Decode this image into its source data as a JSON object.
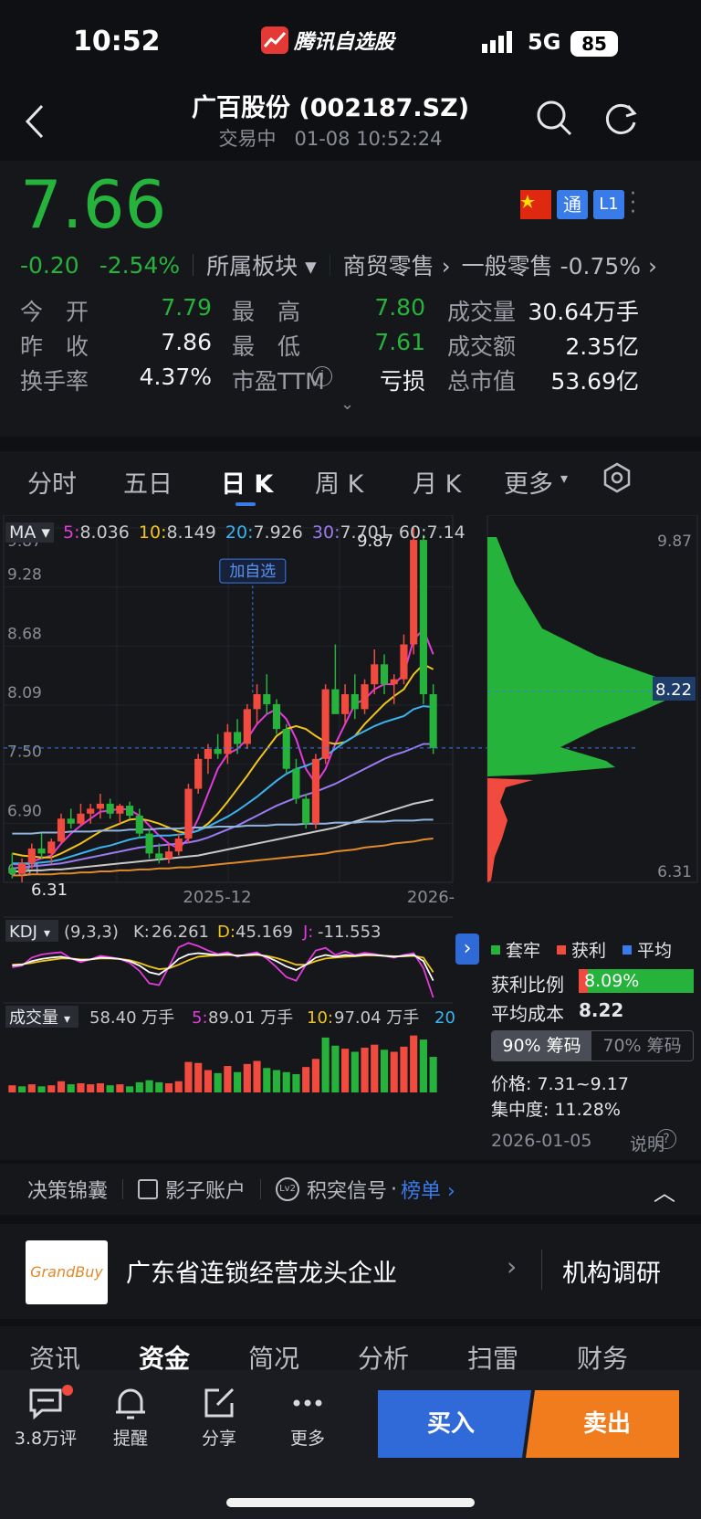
{
  "status": {
    "time": "10:52",
    "app_name": "腾讯自选股",
    "network": "5G",
    "battery": "85"
  },
  "header": {
    "title": "广百股份 (002187.SZ)",
    "state": "交易中",
    "datetime": "01-08 10:52:24"
  },
  "quote": {
    "price": "7.66",
    "change": "-0.20",
    "change_pct": "-2.54%",
    "sector_label": "所属板块",
    "sector1": "商贸零售",
    "sector2": "一般零售",
    "sector2_pct": "-0.75%",
    "badge_tong": "通",
    "badge_l1": "L1",
    "stats": [
      {
        "label": "今　开",
        "value": "7.79",
        "color": "green"
      },
      {
        "label": "最　高",
        "value": "7.80",
        "color": "green"
      },
      {
        "label": "成交量",
        "value": "30.64万手",
        "color": "white"
      },
      {
        "label": "昨　收",
        "value": "7.86",
        "color": "white"
      },
      {
        "label": "最　低",
        "value": "7.61",
        "color": "green"
      },
      {
        "label": "成交额",
        "value": "2.35亿",
        "color": "white"
      },
      {
        "label": "换手率",
        "value": "4.37%",
        "color": "white"
      },
      {
        "label": "市盈TTM",
        "value": "亏损",
        "color": "white"
      },
      {
        "label": "总市值",
        "value": "53.69亿",
        "color": "white"
      }
    ]
  },
  "tabs": [
    "分时",
    "五日",
    "日 K",
    "周 K",
    "月 K",
    "更多"
  ],
  "ma": {
    "label": "MA",
    "items": [
      {
        "k": "5",
        "v": "8.036",
        "color": "#e23bd9"
      },
      {
        "k": "10",
        "v": "8.149",
        "color": "#f0c419"
      },
      {
        "k": "20",
        "v": "7.926",
        "color": "#3ab3f0"
      },
      {
        "k": "30",
        "v": "7.701",
        "color": "#9b7bf0"
      },
      {
        "k": "60",
        "v": "7.14",
        "color": "#c9c9c9"
      }
    ]
  },
  "chart_data": {
    "type": "candlestick",
    "y_ticks": [
      "9.87",
      "9.28",
      "8.68",
      "8.09",
      "7.50",
      "6.90",
      "6.31"
    ],
    "ylim": [
      6.31,
      9.87
    ],
    "x_labels": [
      "2025-12",
      "2026-"
    ],
    "high_label": "9.87",
    "low_label": "6.31",
    "add_watch": "加自选",
    "candles": [
      [
        6.45,
        6.6,
        6.35,
        6.4
      ],
      [
        6.4,
        6.55,
        6.31,
        6.5
      ],
      [
        6.5,
        6.7,
        6.45,
        6.65
      ],
      [
        6.65,
        6.8,
        6.55,
        6.6
      ],
      [
        6.6,
        6.75,
        6.5,
        6.72
      ],
      [
        6.72,
        7.0,
        6.7,
        6.95
      ],
      [
        6.95,
        7.05,
        6.85,
        6.9
      ],
      [
        6.9,
        7.1,
        6.88,
        7.0
      ],
      [
        7.0,
        7.1,
        6.9,
        7.05
      ],
      [
        7.05,
        7.2,
        6.95,
        7.1
      ],
      [
        7.1,
        7.15,
        6.95,
        7.0
      ],
      [
        7.0,
        7.1,
        6.9,
        7.08
      ],
      [
        7.08,
        7.12,
        6.95,
        6.98
      ],
      [
        6.98,
        7.05,
        6.75,
        6.8
      ],
      [
        6.8,
        6.85,
        6.55,
        6.6
      ],
      [
        6.6,
        6.7,
        6.5,
        6.55
      ],
      [
        6.55,
        6.7,
        6.5,
        6.62
      ],
      [
        6.62,
        6.8,
        6.58,
        6.75
      ],
      [
        6.75,
        7.3,
        6.7,
        7.25
      ],
      [
        7.25,
        7.6,
        7.2,
        7.55
      ],
      [
        7.55,
        7.7,
        7.4,
        7.65
      ],
      [
        7.65,
        7.8,
        7.55,
        7.6
      ],
      [
        7.6,
        7.9,
        7.5,
        7.82
      ],
      [
        7.82,
        7.95,
        7.6,
        7.7
      ],
      [
        7.7,
        8.1,
        7.65,
        8.05
      ],
      [
        8.05,
        8.3,
        7.9,
        8.2
      ],
      [
        8.2,
        8.4,
        8.0,
        8.1
      ],
      [
        8.1,
        8.15,
        7.8,
        7.85
      ],
      [
        7.85,
        7.9,
        7.4,
        7.45
      ],
      [
        7.45,
        7.55,
        7.1,
        7.15
      ],
      [
        7.15,
        7.2,
        6.85,
        6.9
      ],
      [
        6.9,
        7.6,
        6.85,
        7.55
      ],
      [
        7.55,
        8.3,
        7.5,
        8.25
      ],
      [
        8.25,
        8.7,
        8.1,
        8.0
      ],
      [
        8.0,
        8.3,
        7.9,
        8.2
      ],
      [
        8.2,
        8.4,
        7.95,
        8.05
      ],
      [
        8.05,
        8.35,
        8.0,
        8.3
      ],
      [
        8.3,
        8.65,
        8.2,
        8.5
      ],
      [
        8.5,
        8.6,
        8.2,
        8.3
      ],
      [
        8.3,
        8.4,
        8.1,
        8.35
      ],
      [
        8.35,
        8.8,
        8.3,
        8.7
      ],
      [
        8.7,
        9.87,
        8.6,
        9.75
      ],
      [
        9.75,
        9.8,
        8.1,
        8.2
      ],
      [
        8.2,
        8.3,
        7.6,
        7.66
      ]
    ],
    "ma": [
      {
        "name": "5",
        "color": "#e23bd9",
        "values": [
          6.5,
          6.48,
          6.52,
          6.55,
          6.58,
          6.7,
          6.8,
          6.88,
          6.95,
          7.02,
          7.03,
          7.05,
          7.04,
          6.98,
          6.88,
          6.78,
          6.7,
          6.65,
          6.75,
          6.95,
          7.2,
          7.45,
          7.6,
          7.65,
          7.75,
          7.9,
          8.0,
          8.05,
          7.95,
          7.75,
          7.45,
          7.3,
          7.45,
          7.7,
          7.9,
          8.1,
          8.15,
          8.25,
          8.3,
          8.3,
          8.4,
          8.75,
          8.85,
          8.6
        ]
      },
      {
        "name": "10",
        "color": "#f0c419",
        "values": [
          6.6,
          6.58,
          6.57,
          6.56,
          6.56,
          6.6,
          6.65,
          6.7,
          6.76,
          6.82,
          6.86,
          6.9,
          6.94,
          6.95,
          6.93,
          6.9,
          6.86,
          6.82,
          6.8,
          6.83,
          6.9,
          7.0,
          7.12,
          7.25,
          7.38,
          7.52,
          7.65,
          7.78,
          7.85,
          7.88,
          7.85,
          7.78,
          7.72,
          7.7,
          7.72,
          7.78,
          7.9,
          8.0,
          8.1,
          8.18,
          8.25,
          8.4,
          8.5,
          8.45
        ]
      },
      {
        "name": "20",
        "color": "#3ab3f0",
        "values": [
          6.5,
          6.5,
          6.5,
          6.51,
          6.52,
          6.54,
          6.57,
          6.6,
          6.63,
          6.66,
          6.68,
          6.71,
          6.74,
          6.76,
          6.77,
          6.78,
          6.78,
          6.79,
          6.8,
          6.83,
          6.87,
          6.92,
          6.97,
          7.03,
          7.1,
          7.17,
          7.25,
          7.33,
          7.4,
          7.45,
          7.48,
          7.52,
          7.58,
          7.65,
          7.72,
          7.78,
          7.83,
          7.88,
          7.92,
          7.95,
          7.98,
          8.05,
          8.08,
          8.07
        ]
      },
      {
        "name": "30",
        "color": "#9b7bf0",
        "values": [
          6.45,
          6.46,
          6.47,
          6.48,
          6.49,
          6.5,
          6.52,
          6.54,
          6.56,
          6.58,
          6.6,
          6.62,
          6.64,
          6.66,
          6.67,
          6.68,
          6.69,
          6.7,
          6.71,
          6.73,
          6.76,
          6.8,
          6.84,
          6.88,
          6.93,
          6.98,
          7.03,
          7.08,
          7.12,
          7.16,
          7.19,
          7.22,
          7.26,
          7.3,
          7.35,
          7.4,
          7.45,
          7.5,
          7.55,
          7.59,
          7.62,
          7.66,
          7.7,
          7.7
        ]
      },
      {
        "name": "60",
        "color": "#c9c9c9",
        "values": [
          6.42,
          6.42,
          6.43,
          6.43,
          6.44,
          6.44,
          6.45,
          6.46,
          6.47,
          6.48,
          6.49,
          6.5,
          6.51,
          6.52,
          6.53,
          6.54,
          6.55,
          6.56,
          6.57,
          6.58,
          6.6,
          6.62,
          6.64,
          6.66,
          6.68,
          6.7,
          6.72,
          6.74,
          6.76,
          6.78,
          6.8,
          6.82,
          6.84,
          6.86,
          6.89,
          6.92,
          6.95,
          6.98,
          7.01,
          7.04,
          7.07,
          7.1,
          7.12,
          7.14
        ]
      },
      {
        "name": "120",
        "color": "#e28a2b",
        "values": [
          6.38,
          6.38,
          6.39,
          6.39,
          6.39,
          6.4,
          6.4,
          6.41,
          6.41,
          6.42,
          6.42,
          6.43,
          6.43,
          6.44,
          6.44,
          6.45,
          6.45,
          6.46,
          6.46,
          6.47,
          6.48,
          6.49,
          6.5,
          6.51,
          6.52,
          6.53,
          6.54,
          6.55,
          6.56,
          6.57,
          6.58,
          6.59,
          6.6,
          6.62,
          6.63,
          6.64,
          6.66,
          6.67,
          6.68,
          6.7,
          6.71,
          6.72,
          6.74,
          6.75
        ]
      },
      {
        "name": "250",
        "color": "#8fb4e0",
        "values": [
          6.8,
          6.8,
          6.8,
          6.81,
          6.81,
          6.81,
          6.82,
          6.82,
          6.82,
          6.83,
          6.83,
          6.83,
          6.84,
          6.84,
          6.84,
          6.85,
          6.85,
          6.85,
          6.86,
          6.86,
          6.86,
          6.87,
          6.87,
          6.87,
          6.88,
          6.88,
          6.88,
          6.89,
          6.89,
          6.89,
          6.9,
          6.9,
          6.9,
          6.91,
          6.91,
          6.91,
          6.92,
          6.92,
          6.92,
          6.93,
          6.93,
          6.93,
          6.94,
          6.94
        ]
      }
    ],
    "ref_line": 7.66,
    "kdj": {
      "label": "KDJ",
      "params": "(9,3,3)",
      "K": "26.261",
      "D": "45.169",
      "J": "-11.553",
      "k_values": [
        60,
        62,
        70,
        75,
        78,
        80,
        76,
        72,
        74,
        78,
        77,
        75,
        70,
        60,
        45,
        40,
        55,
        75,
        85,
        88,
        86,
        84,
        86,
        82,
        84,
        86,
        80,
        70,
        58,
        50,
        62,
        78,
        84,
        80,
        84,
        82,
        85,
        84,
        82,
        80,
        82,
        84,
        70,
        26
      ],
      "d_values": [
        62,
        63,
        66,
        70,
        73,
        76,
        76,
        74,
        74,
        76,
        76,
        75,
        72,
        66,
        58,
        52,
        54,
        62,
        72,
        80,
        82,
        83,
        84,
        83,
        83,
        84,
        82,
        77,
        70,
        62,
        62,
        70,
        76,
        78,
        80,
        81,
        83,
        83,
        82,
        81,
        81,
        82,
        78,
        45
      ],
      "j_values": [
        56,
        60,
        78,
        85,
        88,
        90,
        76,
        68,
        74,
        82,
        79,
        75,
        66,
        48,
        20,
        16,
        57,
        101,
        111,
        104,
        94,
        86,
        90,
        80,
        86,
        90,
        76,
        56,
        34,
        26,
        62,
        94,
        100,
        84,
        92,
        84,
        89,
        86,
        82,
        78,
        84,
        88,
        54,
        -12
      ]
    },
    "volume": {
      "label": "成交量",
      "value": "58.40 万手",
      "ma5": "89.01 万手",
      "ma10": "97.04 万手",
      "ma20": "20",
      "bars": [
        14,
        12,
        16,
        12,
        14,
        22,
        16,
        18,
        16,
        18,
        14,
        16,
        12,
        20,
        24,
        20,
        18,
        22,
        60,
        58,
        44,
        38,
        52,
        40,
        56,
        62,
        48,
        44,
        40,
        36,
        50,
        66,
        108,
        92,
        86,
        80,
        88,
        94,
        84,
        80,
        90,
        112,
        104,
        70
      ],
      "colors": [
        "r",
        "g",
        "r",
        "g",
        "r",
        "r",
        "g",
        "r",
        "r",
        "r",
        "g",
        "r",
        "g",
        "g",
        "g",
        "g",
        "r",
        "r",
        "r",
        "r",
        "r",
        "g",
        "r",
        "g",
        "r",
        "r",
        "g",
        "g",
        "g",
        "g",
        "r",
        "r",
        "g",
        "g",
        "r",
        "g",
        "r",
        "r",
        "g",
        "r",
        "r",
        "r",
        "g",
        "g"
      ]
    }
  },
  "chips": {
    "y_top": "9.87",
    "y_bottom": "6.31",
    "avg_cost_tag": "8.22",
    "legend": [
      {
        "t": "套牢",
        "c": "#25b33b"
      },
      {
        "t": "获利",
        "c": "#f14b3f"
      },
      {
        "t": "平均",
        "c": "#3a7bea"
      }
    ],
    "profit_label": "获利比例",
    "profit_value": "8.09%",
    "avg_label": "平均成本",
    "avg_value": "8.22",
    "tab1": "90% 筹码",
    "tab2": "70% 筹码",
    "price_range": "价格: 7.31~9.17",
    "concentration": "集中度: 11.28%",
    "date": "2026-01-05",
    "explain": "说明"
  },
  "strip": {
    "a": "决策锦囊",
    "b": "影子账户",
    "c": "积突信号",
    "d": "榜单"
  },
  "banner": {
    "logo": "GrandBuy",
    "title": "广东省连锁经营龙头企业",
    "action": "机构调研"
  },
  "subtabs": [
    "资讯",
    "资金",
    "简况",
    "分析",
    "扫雷",
    "财务"
  ],
  "bottom": {
    "comments": "3.8万评",
    "remind": "提醒",
    "share": "分享",
    "more": "更多",
    "buy": "买入",
    "sell": "卖出"
  }
}
